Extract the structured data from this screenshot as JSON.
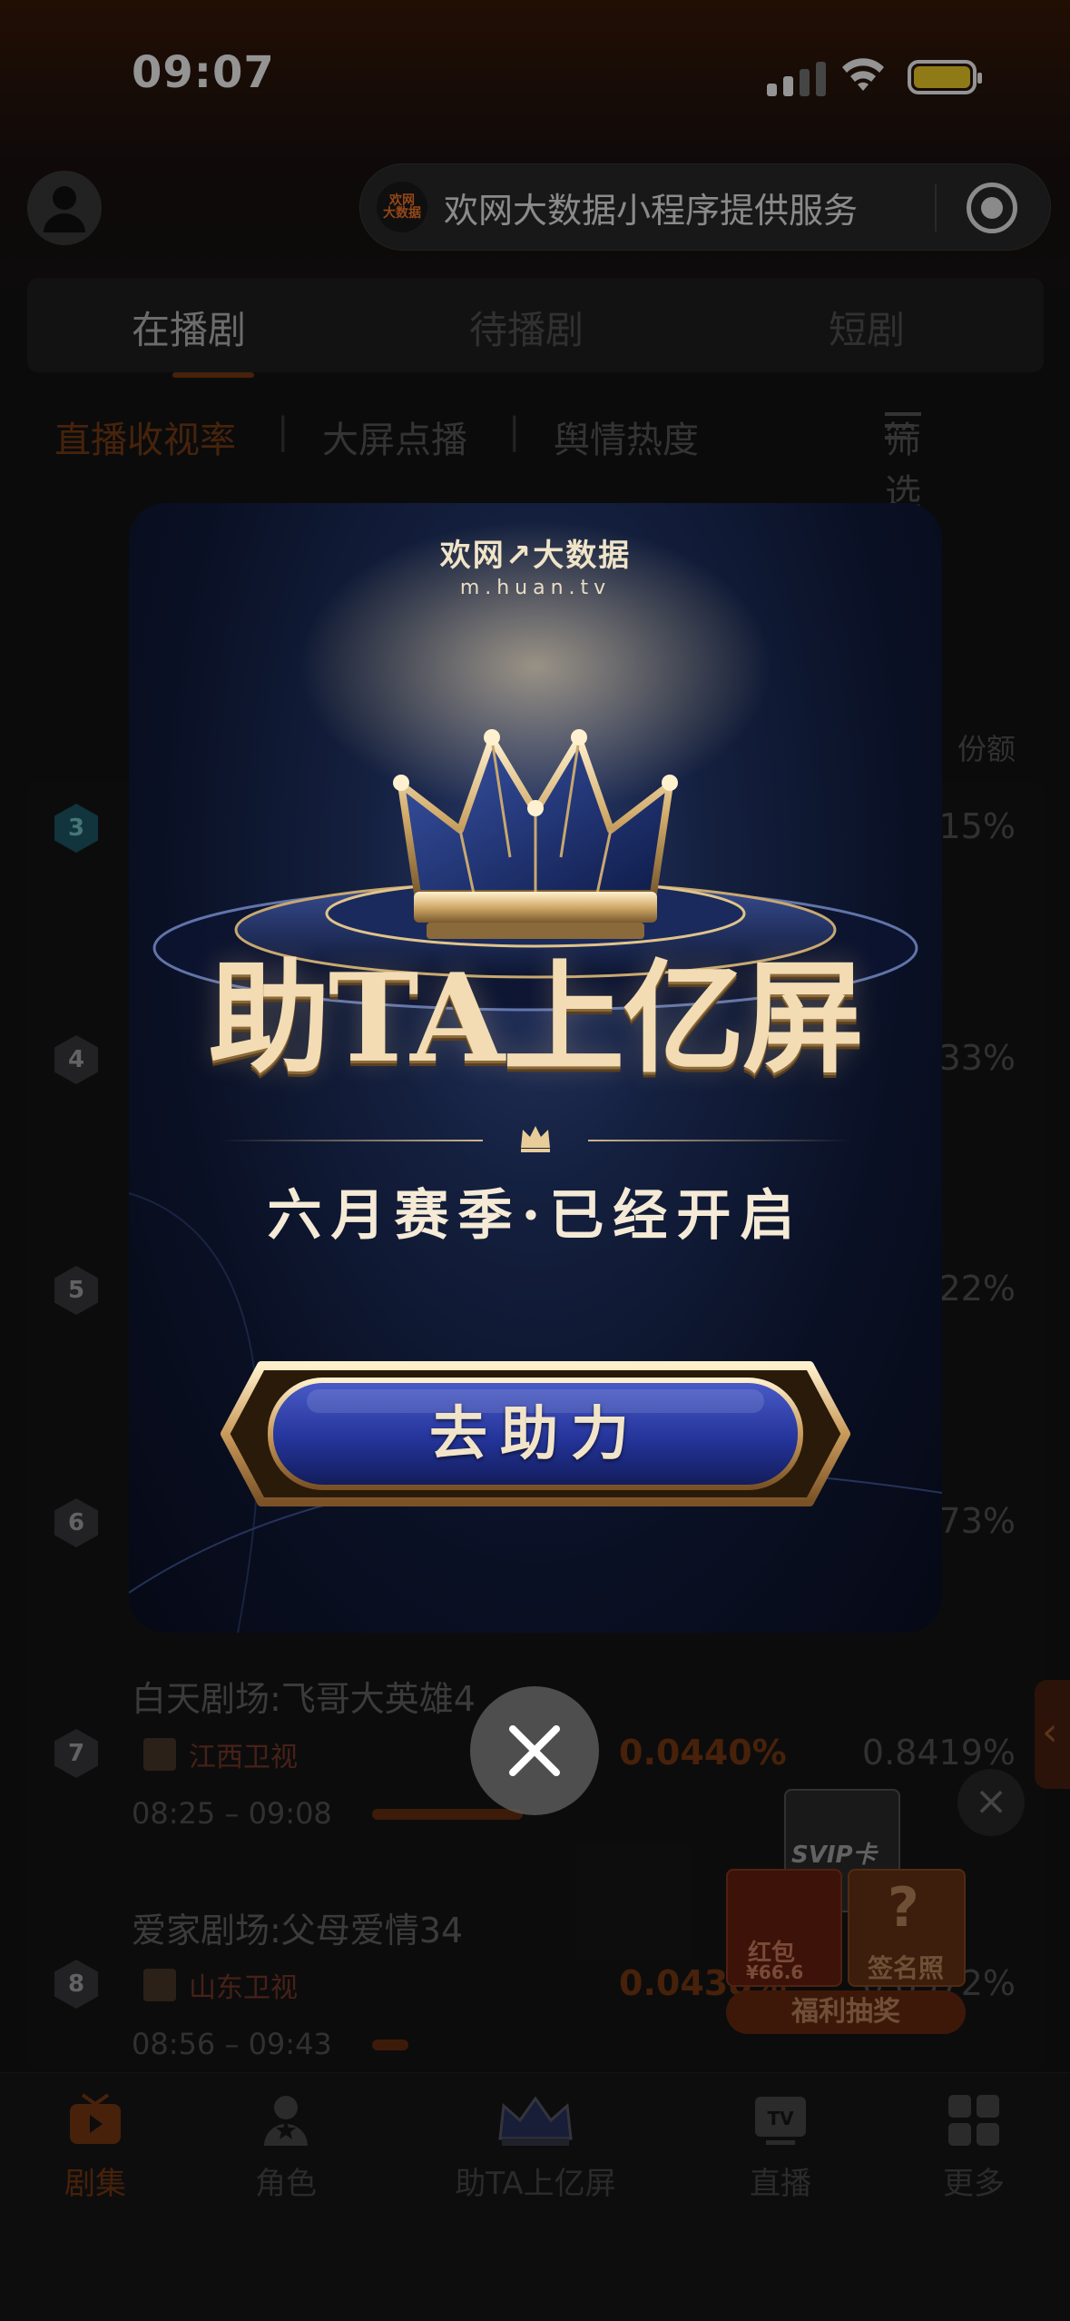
{
  "status_bar": {
    "time": "09:07"
  },
  "mini_program": {
    "logo_text": "欢网大数据",
    "title": "欢网大数据小程序提供服务"
  },
  "tabs": [
    {
      "label": "在播剧",
      "active": true
    },
    {
      "label": "待播剧",
      "active": false
    },
    {
      "label": "短剧",
      "active": false
    }
  ],
  "subtabs": {
    "items": [
      "直播收视率",
      "大屏点播",
      "舆情热度"
    ],
    "divider": "|",
    "filter": "筛选"
  },
  "table": {
    "header_right": "份额",
    "rows": [
      {
        "rank": "3",
        "share": "15%"
      },
      {
        "rank": "4",
        "share": "33%"
      },
      {
        "rank": "5",
        "share": "22%"
      },
      {
        "rank": "6",
        "share": "73%"
      },
      {
        "rank": "7",
        "title": "白天剧场:飞哥大英雄4",
        "channel": "江西卫视",
        "time": "08:25 – 09:08",
        "rate": "0.0440%",
        "share": "0.8419%",
        "progress": 0.84
      },
      {
        "rank": "8",
        "title": "爱家剧场:父母爱情34",
        "channel": "山东卫视",
        "time": "08:56 – 09:43",
        "rate": "0.0438%",
        "share": "0.8572%",
        "progress": 0.17
      }
    ]
  },
  "promo_widget": {
    "svip": "SVIP卡",
    "hongbao": "红包",
    "hongbao_amount": "¥66.6",
    "signed_photo": "签名照",
    "lottery": "福利抽奖"
  },
  "modal": {
    "brand": "欢网↗大数据",
    "brand_url": "m.huan.tv",
    "headline": "助TA上亿屏",
    "subtitle": "六月赛季·已经开启",
    "cta_label": "去助力"
  },
  "bottom_nav": [
    {
      "label": "剧集",
      "icon": "tv-play-icon",
      "active": true
    },
    {
      "label": "角色",
      "icon": "person-star-icon",
      "active": false
    },
    {
      "label": "助TA上亿屏",
      "icon": "crown-icon",
      "active": false
    },
    {
      "label": "直播",
      "icon": "tv-live-icon",
      "active": false
    },
    {
      "label": "更多",
      "icon": "grid-icon",
      "active": false
    }
  ],
  "colors": {
    "accent": "#ff7a2a",
    "modal_gold": "#f3dcb4",
    "modal_blue": "#1e2f77"
  }
}
